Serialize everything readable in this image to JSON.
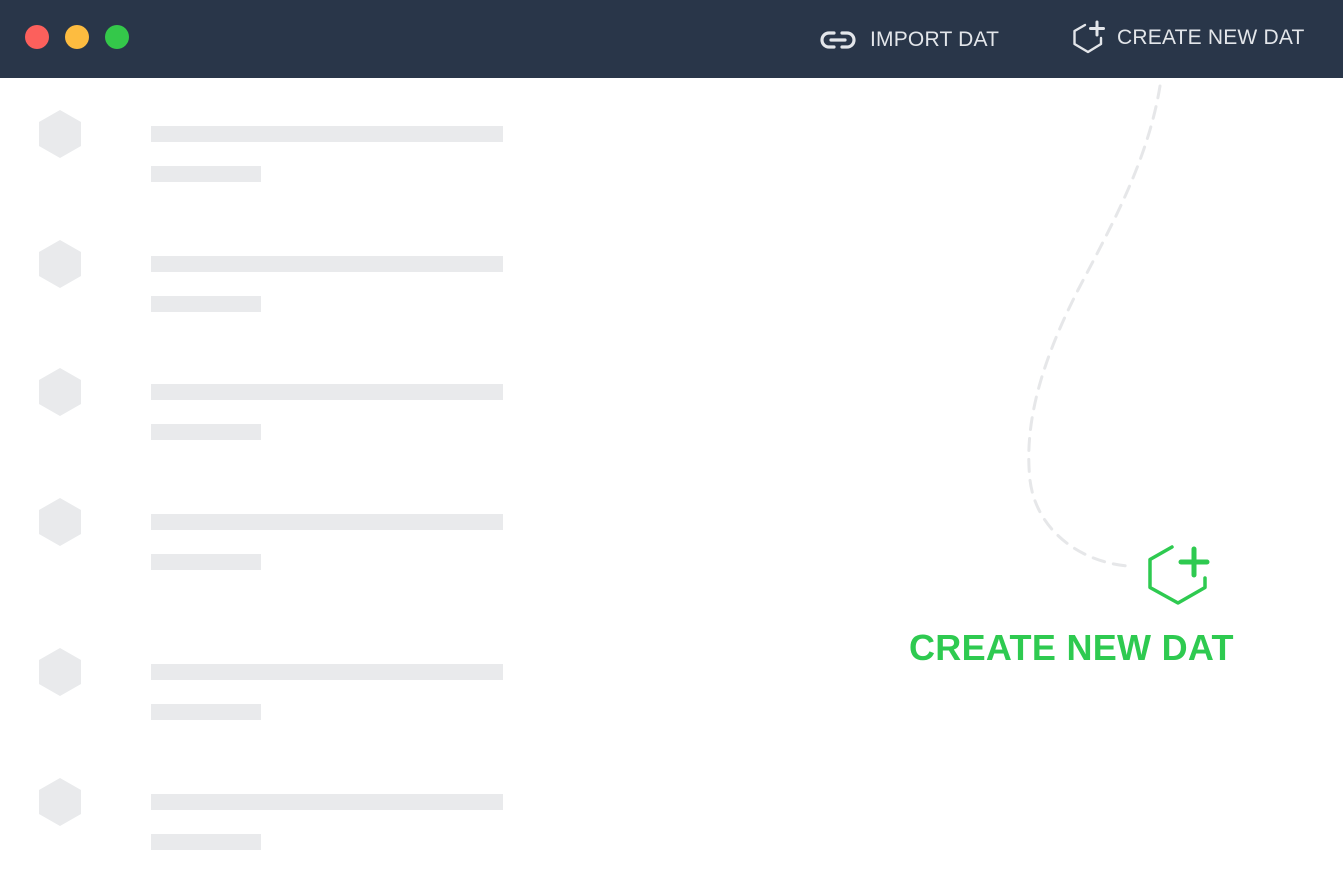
{
  "titlebar": {
    "window_controls": [
      "close",
      "minimize",
      "maximize"
    ],
    "import_button": {
      "label": "IMPORT DAT",
      "icon": "link-icon"
    },
    "create_button": {
      "label": "CREATE NEW DAT",
      "icon": "hexagon-plus-icon"
    }
  },
  "empty_state": {
    "skeleton_rows": 6,
    "cta": {
      "label": "CREATE NEW DAT",
      "icon": "hexagon-plus-icon"
    }
  },
  "colors": {
    "titlebar_bg": "#293649",
    "titlebar_text": "#e3e6ea",
    "accent_green": "#2eca50",
    "skeleton": "#e9eaec",
    "close": "#fc605c",
    "minimize": "#fdbc40",
    "maximize": "#34c84a"
  }
}
